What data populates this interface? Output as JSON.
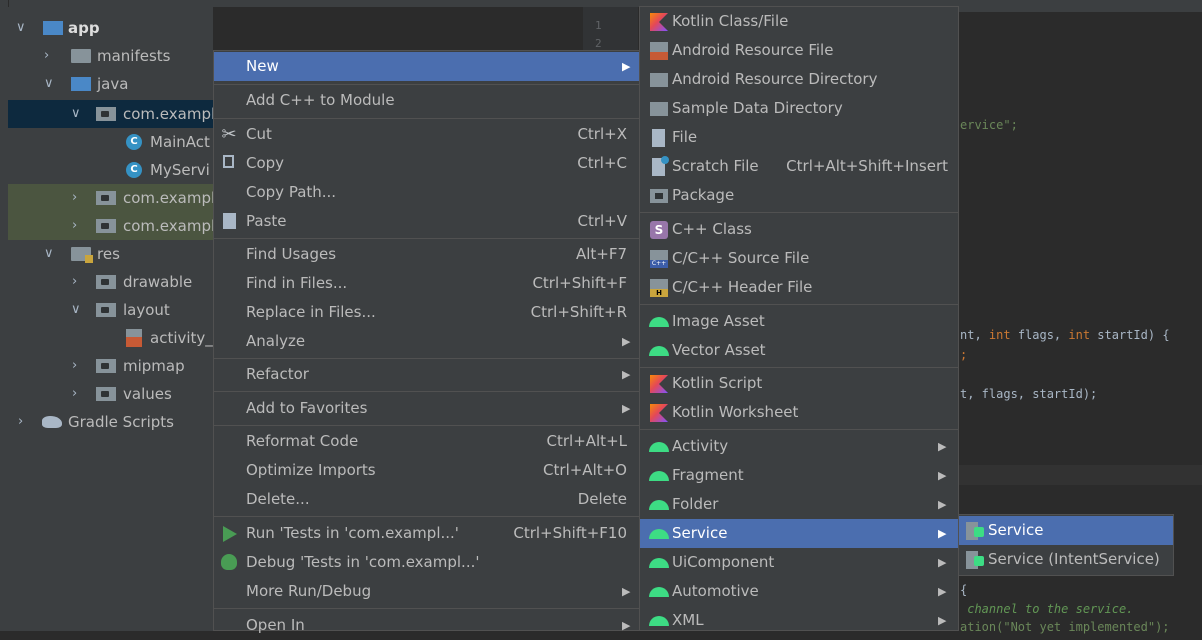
{
  "project_tree": {
    "items": [
      {
        "label": "app",
        "depth": 0,
        "expanded": true,
        "icon": "module-folder-icon",
        "bold": true
      },
      {
        "label": "manifests",
        "depth": 1,
        "expanded": false,
        "icon": "folder-icon"
      },
      {
        "label": "java",
        "depth": 1,
        "expanded": true,
        "icon": "source-folder-icon"
      },
      {
        "label": "com.exampl",
        "depth": 2,
        "expanded": true,
        "icon": "package-icon",
        "selected": true
      },
      {
        "label": "MainAct",
        "depth": 3,
        "icon": "class-icon"
      },
      {
        "label": "MyServi",
        "depth": 3,
        "icon": "class-icon"
      },
      {
        "label": "com.exampl",
        "depth": 2,
        "expanded": false,
        "icon": "package-icon",
        "highlight": true
      },
      {
        "label": "com.exampl",
        "depth": 2,
        "expanded": false,
        "icon": "package-icon",
        "highlight": true
      },
      {
        "label": "res",
        "depth": 1,
        "expanded": true,
        "icon": "resource-folder-icon"
      },
      {
        "label": "drawable",
        "depth": 2,
        "expanded": false,
        "icon": "package-icon"
      },
      {
        "label": "layout",
        "depth": 2,
        "expanded": true,
        "icon": "package-icon"
      },
      {
        "label": "activity_r",
        "depth": 3,
        "icon": "xml-layout-icon"
      },
      {
        "label": "mipmap",
        "depth": 2,
        "expanded": false,
        "icon": "package-icon"
      },
      {
        "label": "values",
        "depth": 2,
        "expanded": false,
        "icon": "package-icon"
      },
      {
        "label": "Gradle Scripts",
        "depth": 0,
        "expanded": false,
        "icon": "gradle-icon"
      }
    ]
  },
  "editor": {
    "line_numbers": [
      "1",
      "2"
    ],
    "fragments": {
      "string_suffix": "ervice\";",
      "sig_a": "nt, ",
      "sig_int1": "int ",
      "sig_flags": "flags, ",
      "sig_int2": "int ",
      "sig_end": "startId) {",
      "semicolon": ";",
      "call": "t, flags, startId);",
      "brace": "{",
      "comment": " channel to the service.",
      "bottom_cut": "ation(\"Not yet implemented\");"
    }
  },
  "context_menu": {
    "items": [
      {
        "label": "New",
        "submenu": true,
        "hover": true
      },
      {
        "label": "Add C++ to Module"
      },
      {
        "label": "Cut",
        "shortcut": "Ctrl+X",
        "icon": "scissors-icon"
      },
      {
        "label": "Copy",
        "shortcut": "Ctrl+C",
        "icon": "copy-icon"
      },
      {
        "label": "Copy Path..."
      },
      {
        "label": "Paste",
        "shortcut": "Ctrl+V",
        "icon": "paste-icon"
      },
      {
        "label": "Find Usages",
        "shortcut": "Alt+F7"
      },
      {
        "label": "Find in Files...",
        "shortcut": "Ctrl+Shift+F"
      },
      {
        "label": "Replace in Files...",
        "shortcut": "Ctrl+Shift+R"
      },
      {
        "label": "Analyze",
        "submenu": true
      },
      {
        "label": "Refactor",
        "submenu": true
      },
      {
        "label": "Add to Favorites",
        "submenu": true
      },
      {
        "label": "Reformat Code",
        "shortcut": "Ctrl+Alt+L"
      },
      {
        "label": "Optimize Imports",
        "shortcut": "Ctrl+Alt+O"
      },
      {
        "label": "Delete...",
        "shortcut": "Delete"
      },
      {
        "label": "Run 'Tests in 'com.exampl...'",
        "shortcut": "Ctrl+Shift+F10",
        "icon": "run-icon"
      },
      {
        "label": "Debug 'Tests in 'com.exampl...'",
        "icon": "debug-icon"
      },
      {
        "label": "More Run/Debug",
        "submenu": true
      },
      {
        "label": "Open In",
        "submenu": true
      }
    ]
  },
  "new_submenu": {
    "items": [
      {
        "label": "Kotlin Class/File",
        "icon": "kotlin-icon"
      },
      {
        "label": "Android Resource File",
        "icon": "resource-file-icon"
      },
      {
        "label": "Android Resource Directory",
        "icon": "folder-icon"
      },
      {
        "label": "Sample Data Directory",
        "icon": "folder-icon"
      },
      {
        "label": "File",
        "icon": "file-icon"
      },
      {
        "label": "Scratch File",
        "shortcut": "Ctrl+Alt+Shift+Insert",
        "icon": "scratch-file-icon"
      },
      {
        "label": "Package",
        "icon": "package-icon"
      },
      {
        "label": "C++ Class",
        "icon": "cpp-class-icon"
      },
      {
        "label": "C/C++ Source File",
        "icon": "c-source-file-icon"
      },
      {
        "label": "C/C++ Header File",
        "icon": "c-header-file-icon"
      },
      {
        "label": "Image Asset",
        "icon": "android-icon"
      },
      {
        "label": "Vector Asset",
        "icon": "android-icon"
      },
      {
        "label": "Kotlin Script",
        "icon": "kotlin-icon"
      },
      {
        "label": "Kotlin Worksheet",
        "icon": "kotlin-icon"
      },
      {
        "label": "Activity",
        "icon": "android-icon",
        "submenu": true
      },
      {
        "label": "Fragment",
        "icon": "android-icon",
        "submenu": true
      },
      {
        "label": "Folder",
        "icon": "android-icon",
        "submenu": true
      },
      {
        "label": "Service",
        "icon": "android-icon",
        "submenu": true,
        "hover": true
      },
      {
        "label": "UiComponent",
        "icon": "android-icon",
        "submenu": true
      },
      {
        "label": "Automotive",
        "icon": "android-icon",
        "submenu": true
      },
      {
        "label": "XML",
        "icon": "android-icon",
        "submenu": true
      }
    ]
  },
  "service_submenu": {
    "items": [
      {
        "label": "Service",
        "icon": "service-icon",
        "hover": true
      },
      {
        "label": "Service (IntentService)",
        "icon": "service-icon"
      }
    ]
  },
  "glyphs": {
    "expanded": "∨",
    "collapsed": "›",
    "submenu_arrow": "▶",
    "class_letter": "C",
    "cpp_letter": "S",
    "scissors": "✂"
  },
  "colors": {
    "menu_bg": "#3c3f41",
    "hover": "#4b6eaf",
    "selection": "#0d293e",
    "android_green": "#3ddc84"
  }
}
